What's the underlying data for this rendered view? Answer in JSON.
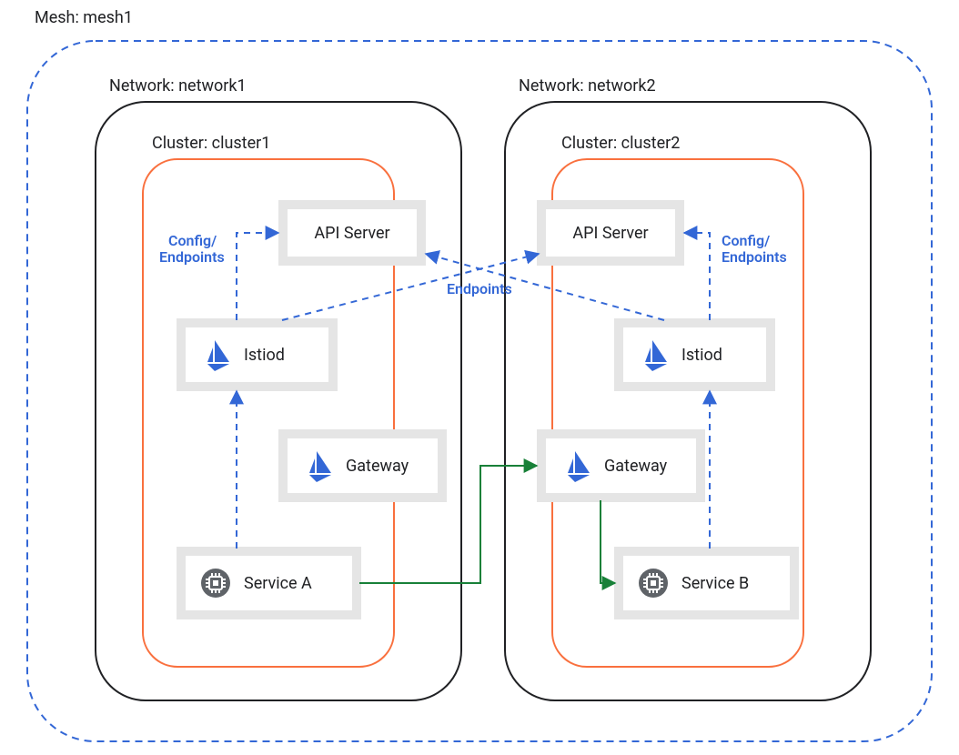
{
  "colors": {
    "blue": "#3367d6",
    "orange": "#f9703e",
    "green": "#188038",
    "iconGray": "#5f6368"
  },
  "mesh": {
    "label": "Mesh: mesh1"
  },
  "networks": {
    "left": {
      "label": "Network: network1"
    },
    "right": {
      "label": "Network: network2"
    }
  },
  "clusters": {
    "left": {
      "label": "Cluster: cluster1"
    },
    "right": {
      "label": "Cluster: cluster2"
    }
  },
  "nodes": {
    "apiServer": {
      "label": "API Server"
    },
    "istiod": {
      "label": "Istiod"
    },
    "gateway": {
      "label": "Gateway"
    },
    "serviceA": {
      "label": "Service A"
    },
    "serviceB": {
      "label": "Service B"
    }
  },
  "edgeLabels": {
    "configEndpoints": "Config/\nEndpoints",
    "configEndpointsL1": "Config/",
    "configEndpointsL2": "Endpoints",
    "endpoints": "Endpoints"
  }
}
